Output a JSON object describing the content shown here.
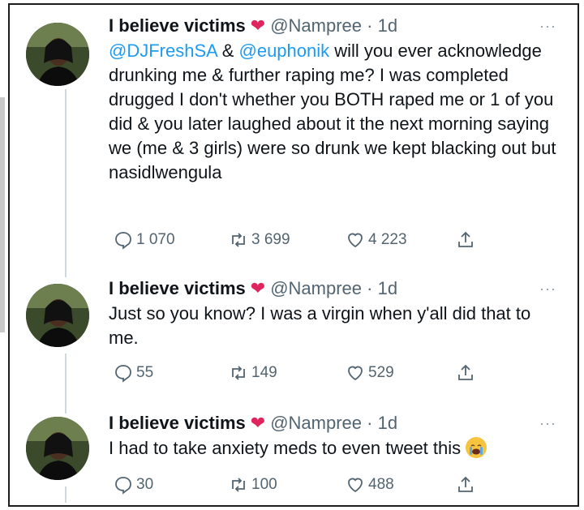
{
  "tweets": [
    {
      "name": "I believe victims",
      "heart_glyph": "❤",
      "handle": "@Nampree",
      "separator": "·",
      "time": "1d",
      "more": "···",
      "mention1": "@DJFreshSA",
      "amp": " & ",
      "mention2": "@euphonik",
      "text": " will you ever acknowledge drunking me & further raping me? I was completed drugged I don't whether you BOTH raped me or 1 of you did & you later laughed about it the next morning saying we (me & 3 girls) were so drunk we kept blacking out but nasidlwengula",
      "replies": "1 070",
      "retweets": "3 699",
      "likes": "4 223"
    },
    {
      "name": "I believe victims",
      "heart_glyph": "❤",
      "handle": "@Nampree",
      "separator": "·",
      "time": "1d",
      "more": "···",
      "text": "Just so you know? I was a virgin when y'all did that to me.",
      "replies": "55",
      "retweets": "149",
      "likes": "529"
    },
    {
      "name": "I believe victims",
      "heart_glyph": "❤",
      "handle": "@Nampree",
      "separator": "·",
      "time": "1d",
      "more": "···",
      "text": "I had to take anxiety meds to even tweet this",
      "emoji": "crying-face-emoji",
      "replies": "30",
      "retweets": "100",
      "likes": "488"
    }
  ],
  "colors": {
    "link": "#1d9bf0",
    "muted": "#536471",
    "heart": "#e0245e",
    "thread_line": "#cfd9de"
  },
  "icons": [
    "reply-icon",
    "retweet-icon",
    "like-icon",
    "share-icon",
    "more-icon"
  ]
}
